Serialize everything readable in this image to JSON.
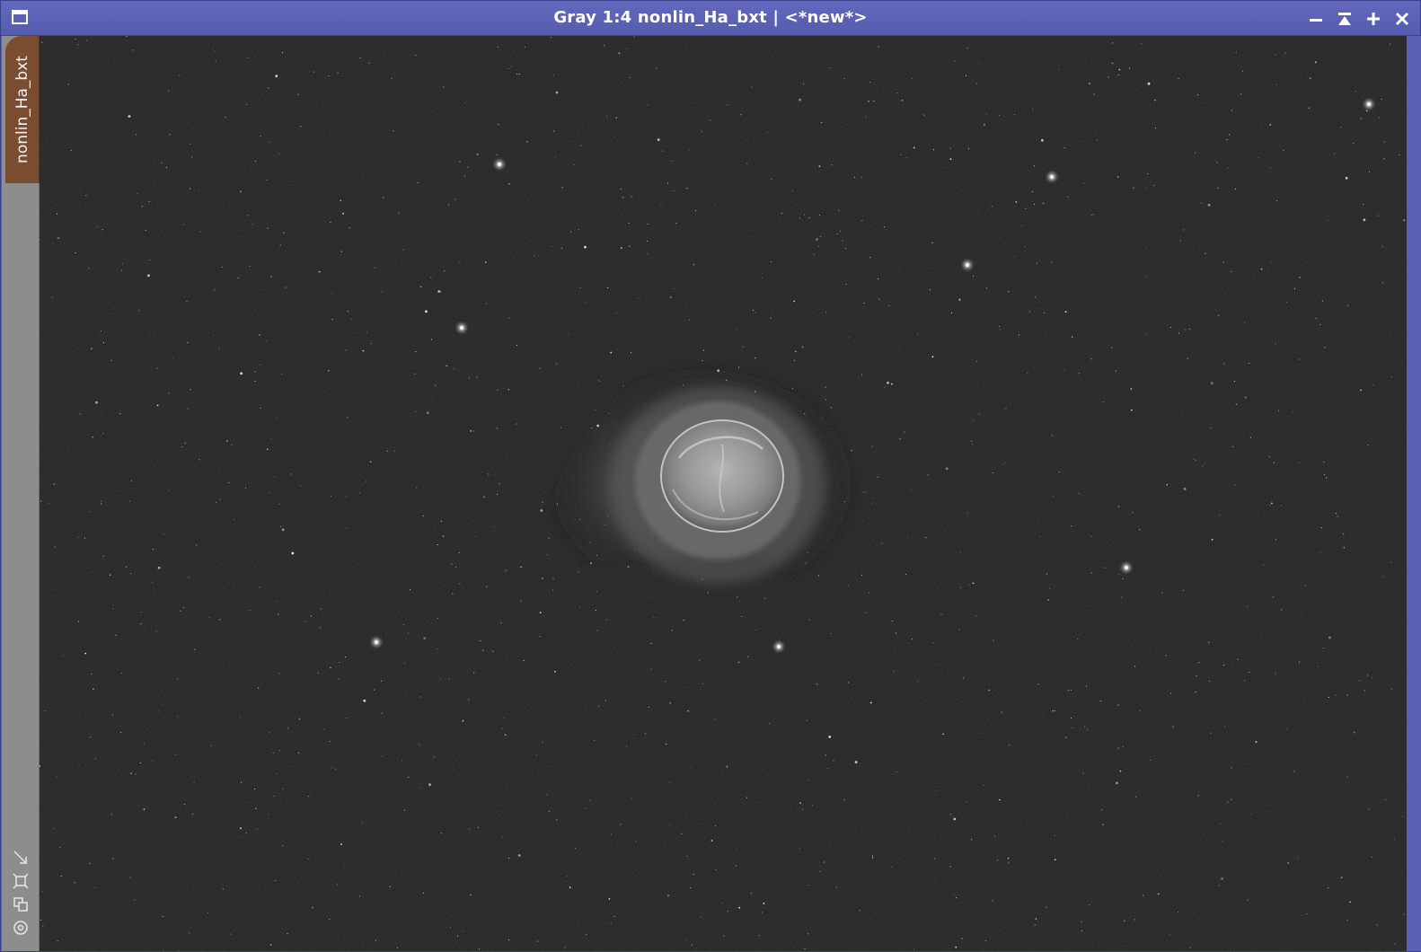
{
  "window": {
    "title": "Gray 1:4 nonlin_Ha_bxt | <*new*>",
    "title_bar_color": "#5a60b4",
    "buttons": [
      {
        "name": "minimize",
        "glyph": "minus-icon"
      },
      {
        "name": "shade",
        "glyph": "shade-icon"
      },
      {
        "name": "maximize",
        "glyph": "plus-icon"
      },
      {
        "name": "close",
        "glyph": "close-icon",
        "label": "✕"
      }
    ]
  },
  "view_tab": {
    "label": "nonlin_Ha_bxt",
    "color": "#7a4d31"
  },
  "tools": [
    {
      "name": "fit-view-icon"
    },
    {
      "name": "zoom-to-fit-icon"
    },
    {
      "name": "clone-view-icon"
    },
    {
      "name": "center-view-icon"
    }
  ],
  "image": {
    "subject": "planetary nebula in H-alpha, grayscale",
    "background_color": "#1c1c1c"
  }
}
